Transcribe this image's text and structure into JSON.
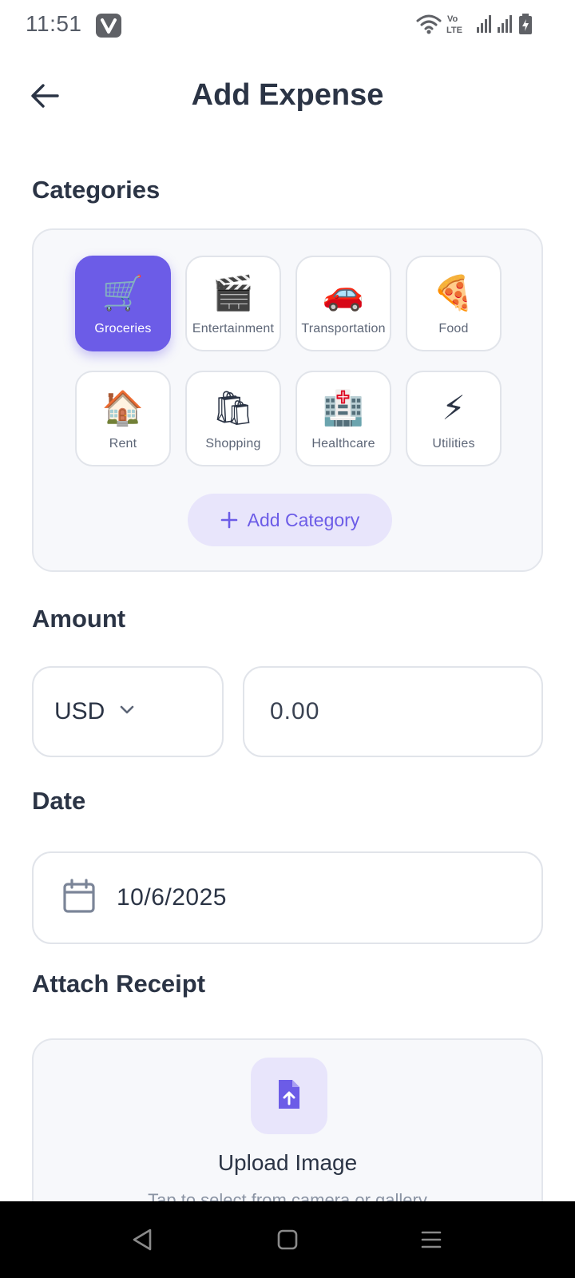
{
  "status_bar": {
    "time": "11:51",
    "app_icon": "v-app-icon",
    "network_label": "Vo LTE"
  },
  "header": {
    "title": "Add Expense",
    "back_icon": "arrow-left-icon"
  },
  "categories": {
    "label": "Categories",
    "selected": "Groceries",
    "items": [
      {
        "label": "Groceries",
        "emoji": "🛒",
        "icon": "shopping-cart-icon"
      },
      {
        "label": "Entertainment",
        "emoji": "🎬",
        "icon": "clapper-board-icon"
      },
      {
        "label": "Transportation",
        "emoji": "🚗",
        "icon": "car-icon"
      },
      {
        "label": "Food",
        "emoji": "🍕",
        "icon": "pizza-icon"
      },
      {
        "label": "Rent",
        "emoji": "🏠",
        "icon": "house-icon"
      },
      {
        "label": "Shopping",
        "emoji": "🛍",
        "icon": "shopping-bags-icon"
      },
      {
        "label": "Healthcare",
        "emoji": "🏥",
        "icon": "hospital-icon"
      },
      {
        "label": "Utilities",
        "emoji": "⚡",
        "icon": "lightning-icon"
      }
    ],
    "add_button_label": "Add Category"
  },
  "amount": {
    "label": "Amount",
    "currency": "USD",
    "value": "0.00"
  },
  "date": {
    "label": "Date",
    "value": "10/6/2025"
  },
  "receipt": {
    "label": "Attach Receipt",
    "upload_title": "Upload Image",
    "upload_subtitle": "Tap to select from camera or gallery"
  },
  "colors": {
    "accent": "#6c5ce7",
    "accent_light": "#e8e5fb",
    "text_primary": "#2b3445",
    "border": "#e1e4ea"
  }
}
